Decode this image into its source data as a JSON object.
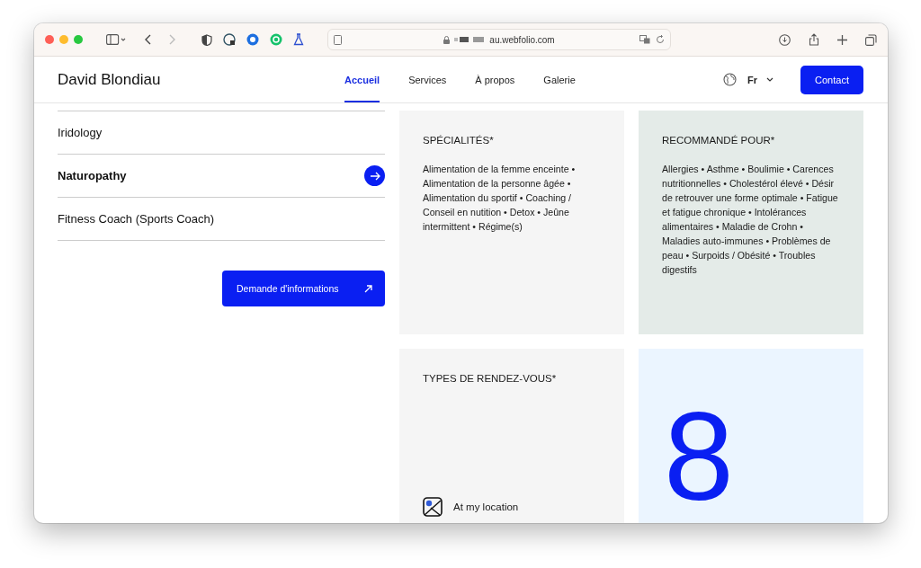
{
  "browser": {
    "url": "au.webfolio.com"
  },
  "header": {
    "brand": "David Blondiau",
    "nav": [
      {
        "label": "Accueil",
        "selected": true
      },
      {
        "label": "Services",
        "selected": false
      },
      {
        "label": "À propos",
        "selected": false
      },
      {
        "label": "Galerie",
        "selected": false
      }
    ],
    "language": "Fr",
    "contact": "Contact"
  },
  "services": [
    {
      "label": "Iridology",
      "selected": false
    },
    {
      "label": "Naturopathy",
      "selected": true
    },
    {
      "label": "Fitness Coach (Sports Coach)",
      "selected": false
    }
  ],
  "info_button": "Demande d'informations",
  "cards": [
    {
      "kind": "text",
      "title": "SPÉCIALITÉS*",
      "body": "Alimentation de la femme enceinte • Alimentation de la personne âgée • Alimentation du sportif • Coaching / Conseil en nutition • Detox • Jeûne intermittent • Régime(s)",
      "color": "#f5f5f5"
    },
    {
      "kind": "text",
      "title": "RECOMMANDÉ POUR*",
      "body": "Allergies • Asthme • Boulimie • Carences nutritionnelles • Cholestérol élevé • Désir de retrouver une forme optimale • Fatigue et fatigue chronique • Intolérances alimentaires • Maladie de Crohn • Maladies auto-immunes • Problèmes de peau • Surpoids / Obésité • Troubles digestifs",
      "color": "#e4ebe8"
    },
    {
      "kind": "types",
      "title": "TYPES DE RENDEZ-VOUS*",
      "option": "At my location",
      "color": "#f5f5f5"
    },
    {
      "kind": "number",
      "value": "8",
      "color": "#ebf5ff"
    }
  ]
}
